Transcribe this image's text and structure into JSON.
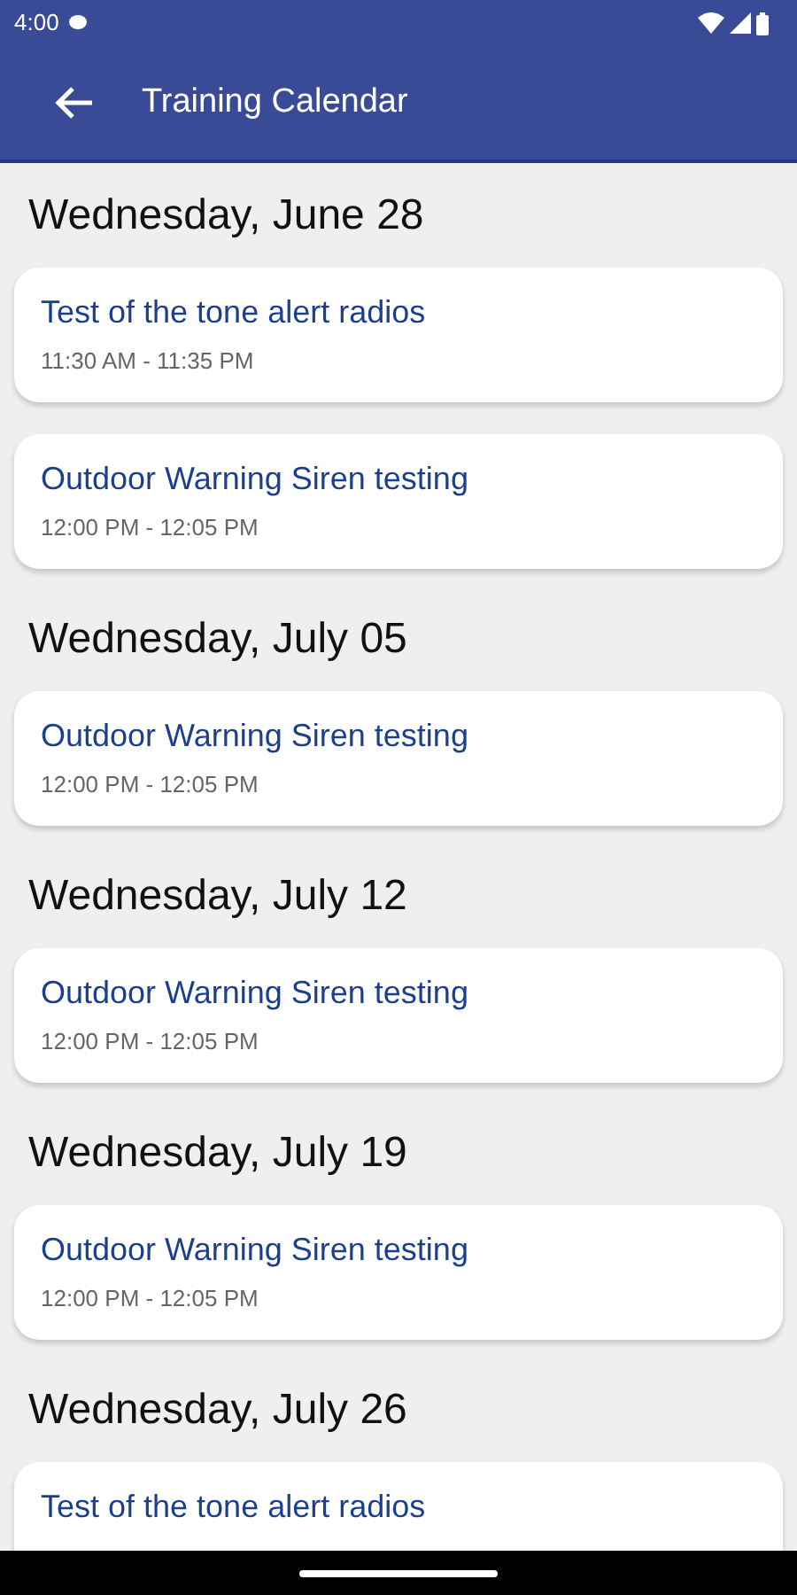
{
  "status_bar": {
    "time": "4:00"
  },
  "app_bar": {
    "title": "Training Calendar"
  },
  "days": [
    {
      "date": "Wednesday, June 28",
      "events": [
        {
          "title": "Test of the tone alert radios",
          "time": "11:30 AM - 11:35 PM"
        },
        {
          "title": "Outdoor Warning Siren testing",
          "time": "12:00 PM - 12:05 PM"
        }
      ]
    },
    {
      "date": "Wednesday, July 05",
      "events": [
        {
          "title": "Outdoor Warning Siren testing",
          "time": "12:00 PM - 12:05 PM"
        }
      ]
    },
    {
      "date": "Wednesday, July 12",
      "events": [
        {
          "title": "Outdoor Warning Siren testing",
          "time": "12:00 PM - 12:05 PM"
        }
      ]
    },
    {
      "date": "Wednesday, July 19",
      "events": [
        {
          "title": "Outdoor Warning Siren testing",
          "time": "12:00 PM - 12:05 PM"
        }
      ]
    },
    {
      "date": "Wednesday, July 26",
      "events": [
        {
          "title": "Test of the tone alert radios"
        }
      ]
    }
  ]
}
